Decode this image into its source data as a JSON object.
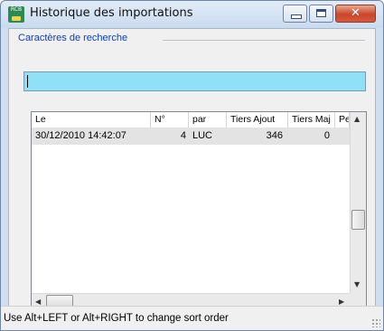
{
  "window": {
    "title": "Historique des importations",
    "app_icon_text": "RCB",
    "controls": {
      "minimize": "minimize",
      "maximize": "maximize",
      "close": "✕"
    }
  },
  "search": {
    "group_label": "Caractères de recherche",
    "value": ""
  },
  "list": {
    "columns": [
      "Le",
      "N°",
      "par",
      "Tiers Ajout",
      "Tiers Maj",
      "Pe"
    ],
    "rows": [
      {
        "date": "30/12/2010 14:42:07",
        "num": "4",
        "par": "LUC",
        "tiers_ajout": "346",
        "tiers_maj": "0",
        "pe": ""
      }
    ]
  },
  "status": {
    "text": "Use Alt+LEFT or Alt+RIGHT to change sort order"
  },
  "colors": {
    "search_bg": "#90e0f8",
    "group_label": "#0b3ec1",
    "close_button": "#c9452b",
    "selected_row": "#e3e3e3"
  }
}
